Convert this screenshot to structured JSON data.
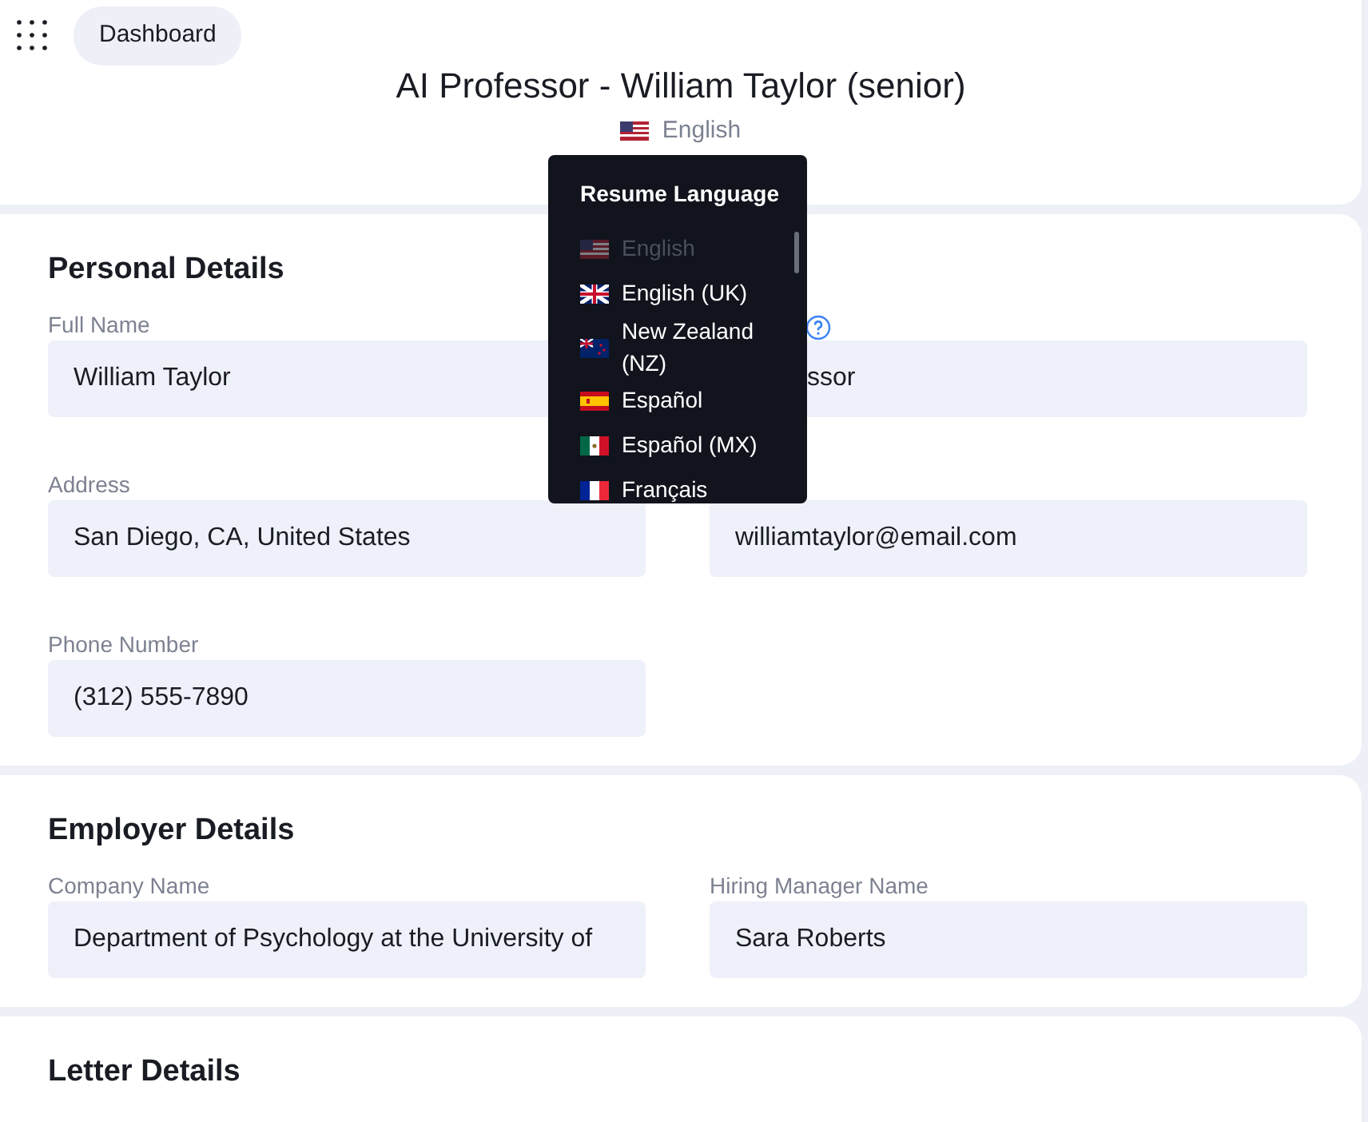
{
  "header": {
    "dashboard_button": "Dashboard",
    "title": "AI Professor - William Taylor (senior)",
    "language": "English"
  },
  "language_menu": {
    "title": "Resume Language",
    "items": [
      {
        "label": "English",
        "kind": "us",
        "disabled": true
      },
      {
        "label": "English (UK)",
        "kind": "uk",
        "disabled": false
      },
      {
        "label": "New Zealand (NZ)",
        "kind": "nz",
        "disabled": false
      },
      {
        "label": "Español",
        "kind": "es",
        "disabled": false
      },
      {
        "label": "Español (MX)",
        "kind": "mx",
        "disabled": false
      },
      {
        "label": "Français",
        "kind": "fr",
        "disabled": false
      }
    ]
  },
  "sections": [
    {
      "title": "Personal Details",
      "fields": [
        {
          "label": "Full Name",
          "value": "William Taylor"
        },
        {
          "help": true,
          "value": "ssor",
          "covered": true
        },
        {
          "label": "Address",
          "value": "San Diego, CA, United States"
        },
        {
          "value": "williamtaylor@email.com"
        },
        {
          "label": "Phone Number",
          "value": "(312) 555-7890"
        }
      ]
    },
    {
      "title": "Employer Details",
      "fields": [
        {
          "label": "Company Name",
          "value": "Department of Psychology at the University of"
        },
        {
          "label": "Hiring Manager Name",
          "value": "Sara Roberts"
        }
      ]
    },
    {
      "title": "Letter Details"
    }
  ]
}
